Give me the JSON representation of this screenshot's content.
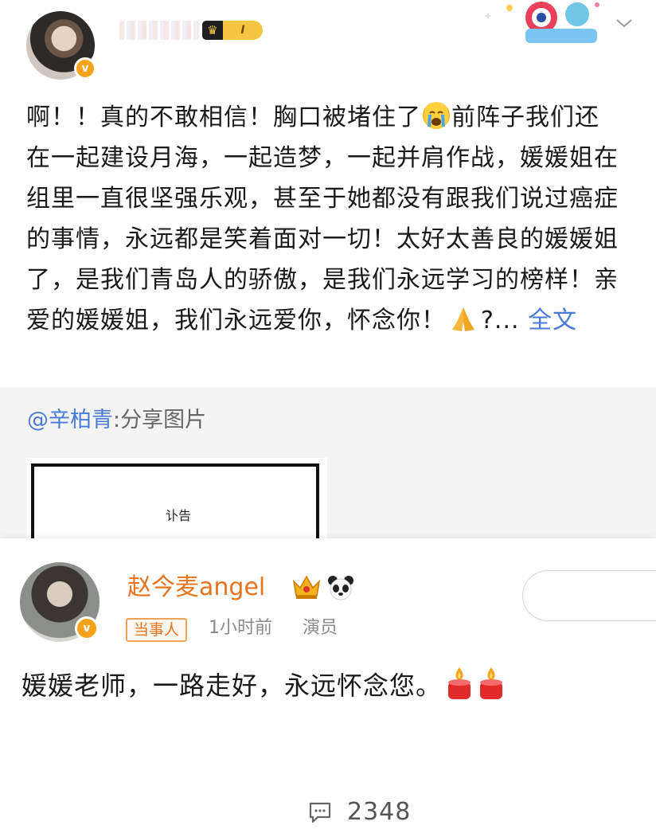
{
  "post": {
    "body": "啊！！真的不敢相信！胸口被堵住了",
    "body_2": "前阵子我们还在一起建设月海，一起造梦，一起并肩作战，媛媛姐在组里一直很坚强乐观，甚至于她都没有跟我们说过癌症的事情，永远都是笑着面对一切！太好太善良的媛媛姐了，是我们青岛人的骄傲，是我们永远学习的榜样！亲爱的媛媛姐，我们永远爱你，怀念你！",
    "body_tail": "?...",
    "fulltext_label": "全文",
    "level_badge": "I",
    "vbadge": "v"
  },
  "share": {
    "mention": "@辛柏青",
    "label": ":分享图片",
    "image_caption": "讣告"
  },
  "reply": {
    "username": "赵今麦angel",
    "tag": "当事人",
    "time": "1小时前",
    "role": "演员",
    "text": "媛媛老师，一路走好，永远怀念您。",
    "vbadge": "v"
  },
  "footer": {
    "comment_count": "2348"
  },
  "colors": {
    "link": "#4a7ad8",
    "username_orange": "#e8731c",
    "gray_text": "#8a8a8a",
    "verified_badge": "#f7a21b"
  },
  "icons": [
    "crying-face-icon",
    "praying-hands-icon",
    "crown-icon",
    "panda-icon",
    "candle-icon",
    "comment-icon",
    "chevron-down-icon"
  ]
}
